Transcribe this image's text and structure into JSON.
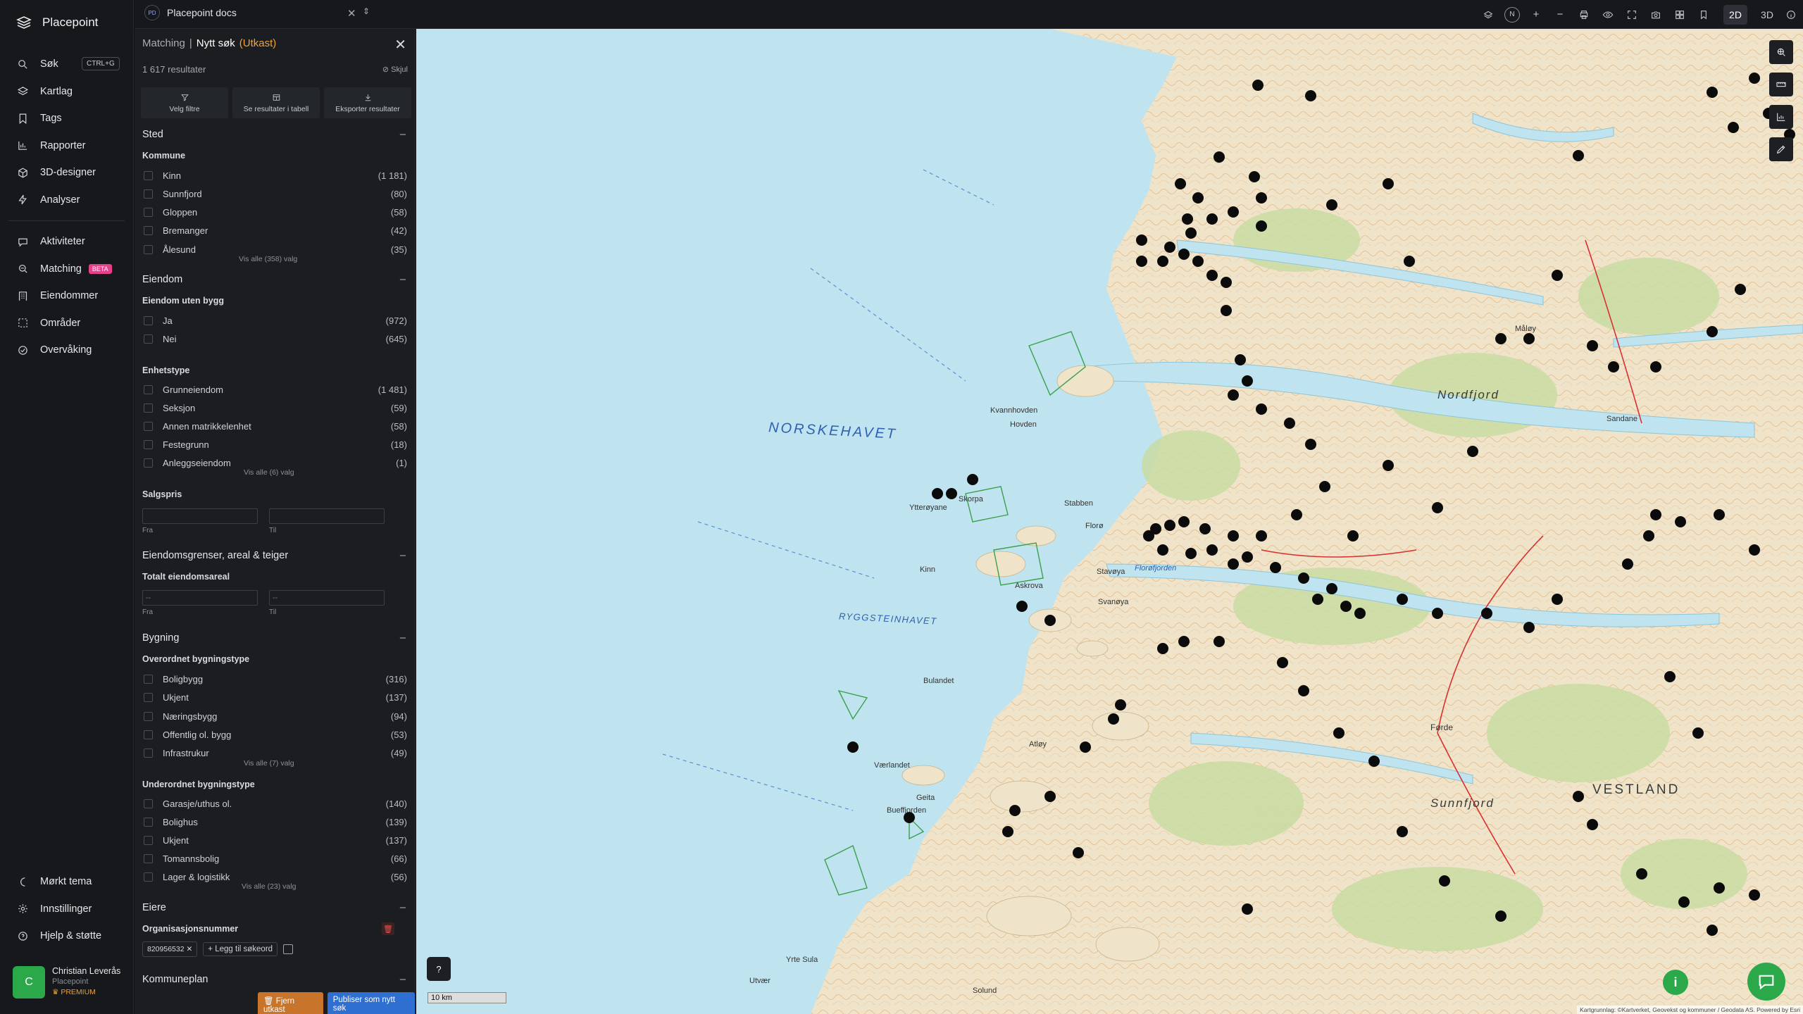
{
  "app": {
    "name": "Placepoint"
  },
  "nav": [
    {
      "label": "Søk",
      "icon": "search-icon",
      "shortcut": "CTRL+G"
    },
    {
      "label": "Kartlag",
      "icon": "layers-icon"
    },
    {
      "label": "Tags",
      "icon": "bookmark-icon"
    },
    {
      "label": "Rapporter",
      "icon": "chart-icon"
    },
    {
      "label": "3D-designer",
      "icon": "cube-icon"
    },
    {
      "label": "Analyser",
      "icon": "bolt-icon"
    },
    {
      "label": "Aktiviteter",
      "icon": "activity-icon"
    },
    {
      "label": "Matching",
      "icon": "match-icon",
      "badge": "BETA"
    },
    {
      "label": "Eiendommer",
      "icon": "building-icon"
    },
    {
      "label": "Områder",
      "icon": "area-icon"
    },
    {
      "label": "Overvåking",
      "icon": "monitor-icon"
    }
  ],
  "bottom_nav": [
    {
      "label": "Mørkt tema",
      "icon": "moon-icon"
    },
    {
      "label": "Innstillinger",
      "icon": "gear-icon"
    },
    {
      "label": "Hjelp & støtte",
      "icon": "help-icon"
    }
  ],
  "user": {
    "initial": "C",
    "name": "Christian Leverås",
    "org": "Placepoint",
    "plan": "PREMIUM"
  },
  "topbar": {
    "doc_initials": "PD",
    "doc_title": "Placepoint docs",
    "mode_2d": "2D",
    "mode_3d": "3D",
    "compass": "N"
  },
  "panel": {
    "crumb": "Matching",
    "separator": "|",
    "title": "Nytt søk",
    "status": "(Utkast)",
    "result_count": "1 617 resultater",
    "hide_label": "Skjul",
    "actions": [
      "Velg filtre",
      "Se resultater i tabell",
      "Eksporter resultater"
    ],
    "sections": {
      "sted": "Sted",
      "eiendom": "Eiendom",
      "grenser": "Eiendomsgrenser, areal & teiger",
      "bygning": "Bygning",
      "eiere": "Eiere",
      "kommuneplan": "Kommuneplan"
    },
    "kommune": {
      "title": "Kommune",
      "options": [
        {
          "label": "Kinn",
          "count": "(1 181)"
        },
        {
          "label": "Sunnfjord",
          "count": "(80)"
        },
        {
          "label": "Gloppen",
          "count": "(58)"
        },
        {
          "label": "Bremanger",
          "count": "(42)"
        },
        {
          "label": "Ålesund",
          "count": "(35)"
        }
      ],
      "show_all": "Vis alle (358) valg"
    },
    "uten_bygg": {
      "title": "Eiendom uten bygg",
      "options": [
        {
          "label": "Ja",
          "count": "(972)"
        },
        {
          "label": "Nei",
          "count": "(645)"
        }
      ]
    },
    "enhetstype": {
      "title": "Enhetstype",
      "options": [
        {
          "label": "Grunneiendom",
          "count": "(1 481)"
        },
        {
          "label": "Seksjon",
          "count": "(59)"
        },
        {
          "label": "Annen matrikkelenhet",
          "count": "(58)"
        },
        {
          "label": "Festegrunn",
          "count": "(18)"
        },
        {
          "label": "Anleggseiendom",
          "count": "(1)"
        }
      ],
      "show_all": "Vis alle (6) valg"
    },
    "salgspris": {
      "title": "Salgspris",
      "from_label": "Fra",
      "to_label": "Til",
      "from_placeholder": "",
      "to_placeholder": ""
    },
    "areal": {
      "title": "Totalt eiendomsareal",
      "from_label": "Fra",
      "to_label": "Til",
      "from_placeholder": "--",
      "to_placeholder": "--"
    },
    "overordnet": {
      "title": "Overordnet bygningstype",
      "options": [
        {
          "label": "Boligbygg",
          "count": "(316)"
        },
        {
          "label": "Ukjent",
          "count": "(137)"
        },
        {
          "label": "Næringsbygg",
          "count": "(94)"
        },
        {
          "label": "Offentlig ol. bygg",
          "count": "(53)"
        },
        {
          "label": "Infrastrukur",
          "count": "(49)"
        }
      ],
      "show_all": "Vis alle (7) valg"
    },
    "underordnet": {
      "title": "Underordnet bygningstype",
      "options": [
        {
          "label": "Garasje/uthus ol.",
          "count": "(140)"
        },
        {
          "label": "Bolighus",
          "count": "(139)"
        },
        {
          "label": "Ukjent",
          "count": "(137)"
        },
        {
          "label": "Tomannsbolig",
          "count": "(66)"
        },
        {
          "label": "Lager & logistikk",
          "count": "(56)"
        }
      ],
      "show_all": "Vis alle (23) valg"
    },
    "orgnr": {
      "title": "Organisasjonsnummer",
      "value": "820956532",
      "add_label": "Legg til søkeord"
    },
    "buttons": {
      "remove_draft": "Fjern utkast",
      "publish": "Publiser som nytt søk"
    }
  },
  "map": {
    "sea_label": "NORSKEHAVET",
    "sea_label2": "RYGGSTEINHAVET",
    "region_label": "VESTLAND",
    "places": [
      "Kinn",
      "Stabben",
      "Florø",
      "Skorpa",
      "Askrova",
      "Svanøya",
      "Stavøya",
      "Værlandet",
      "Bulandet",
      "Geita",
      "Bueffjorden",
      "Atløy",
      "Sunnfjord",
      "Førde",
      "Nordfjord",
      "Florøfjorden",
      "Sandane",
      "Måløy",
      "Kvannhovden",
      "Ytterøyane",
      "Hovden",
      "Utvær",
      "Yrte Sula",
      "Solund"
    ],
    "scale_label": "10 km",
    "attribution": "Kartgrunnlag: ©Kartverket, Geovekst og kommuner / Geodata AS. Powered by Esri",
    "help_icon": "help-icon",
    "colors": {
      "sea": "#bfe4ef",
      "land": "#efe3c9",
      "forest": "#c6dba0",
      "marker": "#0b0b0b",
      "contour": "#d8a26a"
    }
  }
}
